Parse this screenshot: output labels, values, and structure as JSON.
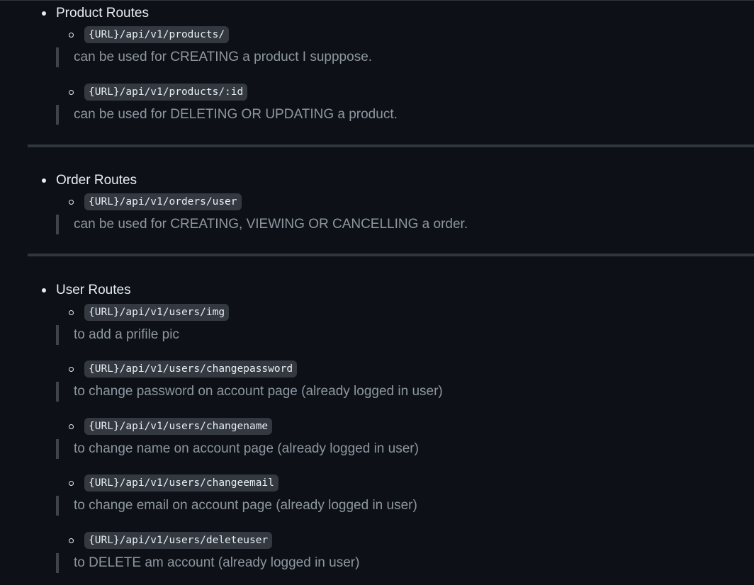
{
  "sections": [
    {
      "title": "Product Routes",
      "routes": [
        {
          "path": "{URL}/api/v1/products/",
          "note": "can be used for CREATING a product I supppose."
        },
        {
          "path": "{URL}/api/v1/products/:id",
          "note": "can be used for DELETING OR UPDATING a product."
        }
      ]
    },
    {
      "title": "Order Routes",
      "routes": [
        {
          "path": "{URL}/api/v1/orders/user",
          "note": "can be used for CREATING, VIEWING OR CANCELLING a order."
        }
      ]
    },
    {
      "title": "User Routes",
      "routes": [
        {
          "path": "{URL}/api/v1/users/img",
          "note": "to add a prifile pic"
        },
        {
          "path": "{URL}/api/v1/users/changepassword",
          "note": "to change password on account page (already logged in user)"
        },
        {
          "path": "{URL}/api/v1/users/changename",
          "note": "to change name on account page (already logged in user)"
        },
        {
          "path": "{URL}/api/v1/users/changeemail",
          "note": "to change email on account page (already logged in user)"
        },
        {
          "path": "{URL}/api/v1/users/deleteuser",
          "note": "to DELETE am account (already logged in user)"
        }
      ]
    }
  ]
}
